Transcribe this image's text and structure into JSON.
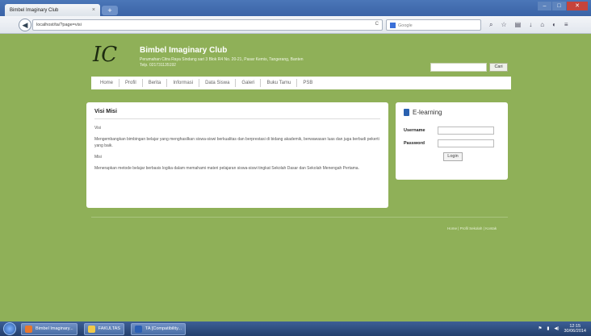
{
  "browser": {
    "tab_title": "Bimbel Imaginary Club",
    "new_tab": "+",
    "url": "localhost/ta/?page=visi",
    "search_placeholder": "Google",
    "reload": "C"
  },
  "site": {
    "logo_text": "IC",
    "name": "Bimbel Imaginary Club",
    "address": "Perumahan Citra Raya Sindang sari 3 Blok R4 No. 20-21, Pasar Kemis, Tangerang, Banten",
    "phone": "Telp. 021731135192",
    "search_button": "Cari",
    "menu": [
      "Home",
      "Profil",
      "Berita",
      "Informasi",
      "Data Siswa",
      "Galeri",
      "Buku Tamu",
      "PSB"
    ]
  },
  "content": {
    "title": "Visi Misi",
    "visi_label": "Visi",
    "visi_text": "Mengembangkan bimbingan belajar yang menghasilkan siswa-siswi berkualitas dan berprestasi di bidang akademik, berwawasan luas dan juga berbudi pekerti yang baik.",
    "misi_label": "Misi",
    "misi_text": "Menerapkan metode belajar berbasis logika dalam memahami materi pelajaran siswa-siswi tingkat Sekolah Dasar dan Sekolah Menengah Pertama."
  },
  "elearning": {
    "title": "E-learning",
    "username_label": "Username",
    "password_label": "Password",
    "login_button": "Login"
  },
  "footer": {
    "link_text": "Home | Profil Sekolah | Kontak"
  },
  "taskbar": {
    "items": [
      "Bimbel Imaginary...",
      "FAKULTAS",
      "TA [Compatibility..."
    ],
    "time": "12:15",
    "date": "30/06/2014"
  }
}
